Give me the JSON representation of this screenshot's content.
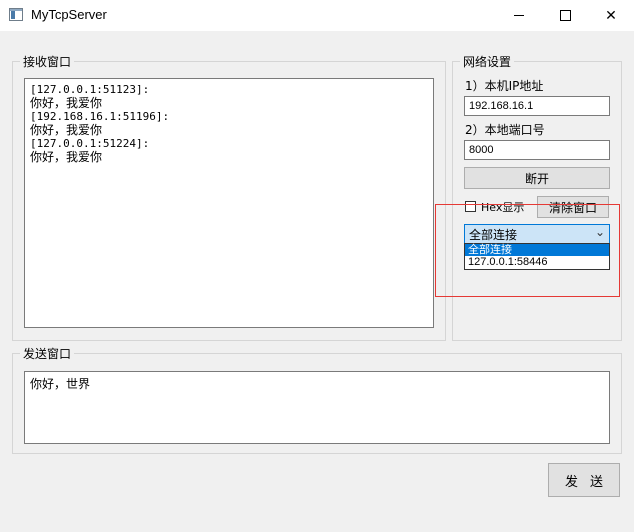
{
  "window": {
    "title": "MyTcpServer",
    "minimize": "—",
    "maximize": "□",
    "close": "✕"
  },
  "receive": {
    "group_title": "接收窗口",
    "lines": [
      "[127.0.0.1:51123]:",
      "你好，我爱你",
      "[192.168.16.1:51196]:",
      "你好，我爱你",
      "[127.0.0.1:51224]:",
      "你好，我爱你"
    ]
  },
  "network": {
    "group_title": "网络设置",
    "ip_label": "1）本机IP地址",
    "ip_value": "192.168.16.1",
    "port_label": "2）本地端口号",
    "port_value": "8000",
    "disconnect_label": "断开",
    "hex_label": "Hex显示",
    "hex_checked": false,
    "clear_label": "清除窗口",
    "connection_selected": "全部连接",
    "connection_options": [
      "全部连接",
      "127.0.0.1:58446"
    ]
  },
  "send": {
    "group_title": "发送窗口",
    "text": "你好，世界",
    "button_label": "发送"
  }
}
